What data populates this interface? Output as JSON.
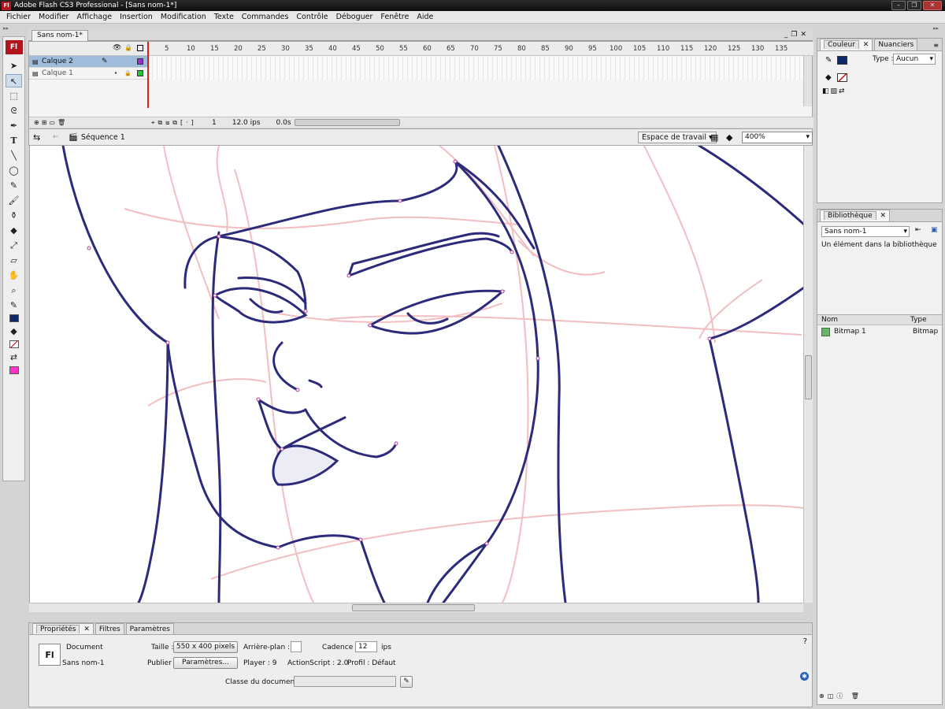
{
  "window": {
    "title": "Adobe Flash CS3 Professional - [Sans nom-1*]",
    "app_icon": "Fl"
  },
  "menu": [
    "Fichier",
    "Modifier",
    "Affichage",
    "Insertion",
    "Modification",
    "Texte",
    "Commandes",
    "Contrôle",
    "Déboguer",
    "Fenêtre",
    "Aide"
  ],
  "document_tab": "Sans nom-1*",
  "timeline": {
    "frame_numbers": [
      "5",
      "10",
      "15",
      "20",
      "25",
      "30",
      "35",
      "40",
      "45",
      "50",
      "55",
      "60",
      "65",
      "70",
      "75",
      "80",
      "85",
      "90",
      "95",
      "100",
      "105",
      "110",
      "115",
      "120",
      "125",
      "130",
      "135"
    ],
    "layers": [
      {
        "name": "Calque 2",
        "active": true,
        "color": "#9b30c8"
      },
      {
        "name": "Calque 1",
        "active": false,
        "color": "#22c632"
      }
    ],
    "current_frame": "1",
    "frame_rate": "12.0 ips",
    "elapsed": "0.0s"
  },
  "edit_bar": {
    "scene": "Séquence 1",
    "workspace": "Espace de travail",
    "zoom": "400%"
  },
  "properties": {
    "tabs": [
      "Propriétés",
      "Filtres",
      "Paramètres"
    ],
    "doc_type": "Document",
    "doc_name": "Sans nom-1",
    "size_label": "Taille :",
    "size_value": "550 x 400 pixels",
    "background_label": "Arrière-plan :",
    "rate_label": "Cadence :",
    "rate_value": "12",
    "rate_unit": "ips",
    "publish_label": "Publier :",
    "publish_button": "Paramètres...",
    "player": "Player : 9",
    "actionscript": "ActionScript : 2.0",
    "profile": "Profil : Défaut",
    "doc_class_label": "Classe du document :",
    "doc_class_value": ""
  },
  "color_panel": {
    "tabs": [
      "Couleur",
      "Nuanciers"
    ],
    "type_label": "Type :",
    "type_value": "Aucun",
    "stroke_color": "#0f2a6b"
  },
  "library": {
    "tab": "Bibliothèque",
    "doc_select": "Sans nom-1",
    "count_text": "Un élément dans la bibliothèque",
    "col_name": "Nom",
    "col_type": "Type",
    "items": [
      {
        "name": "Bitmap 1",
        "type": "Bitmap"
      }
    ]
  },
  "colors": {
    "ink": "#2c2a7a",
    "sketch": "#e88a8f",
    "accent": "#b2161d"
  }
}
